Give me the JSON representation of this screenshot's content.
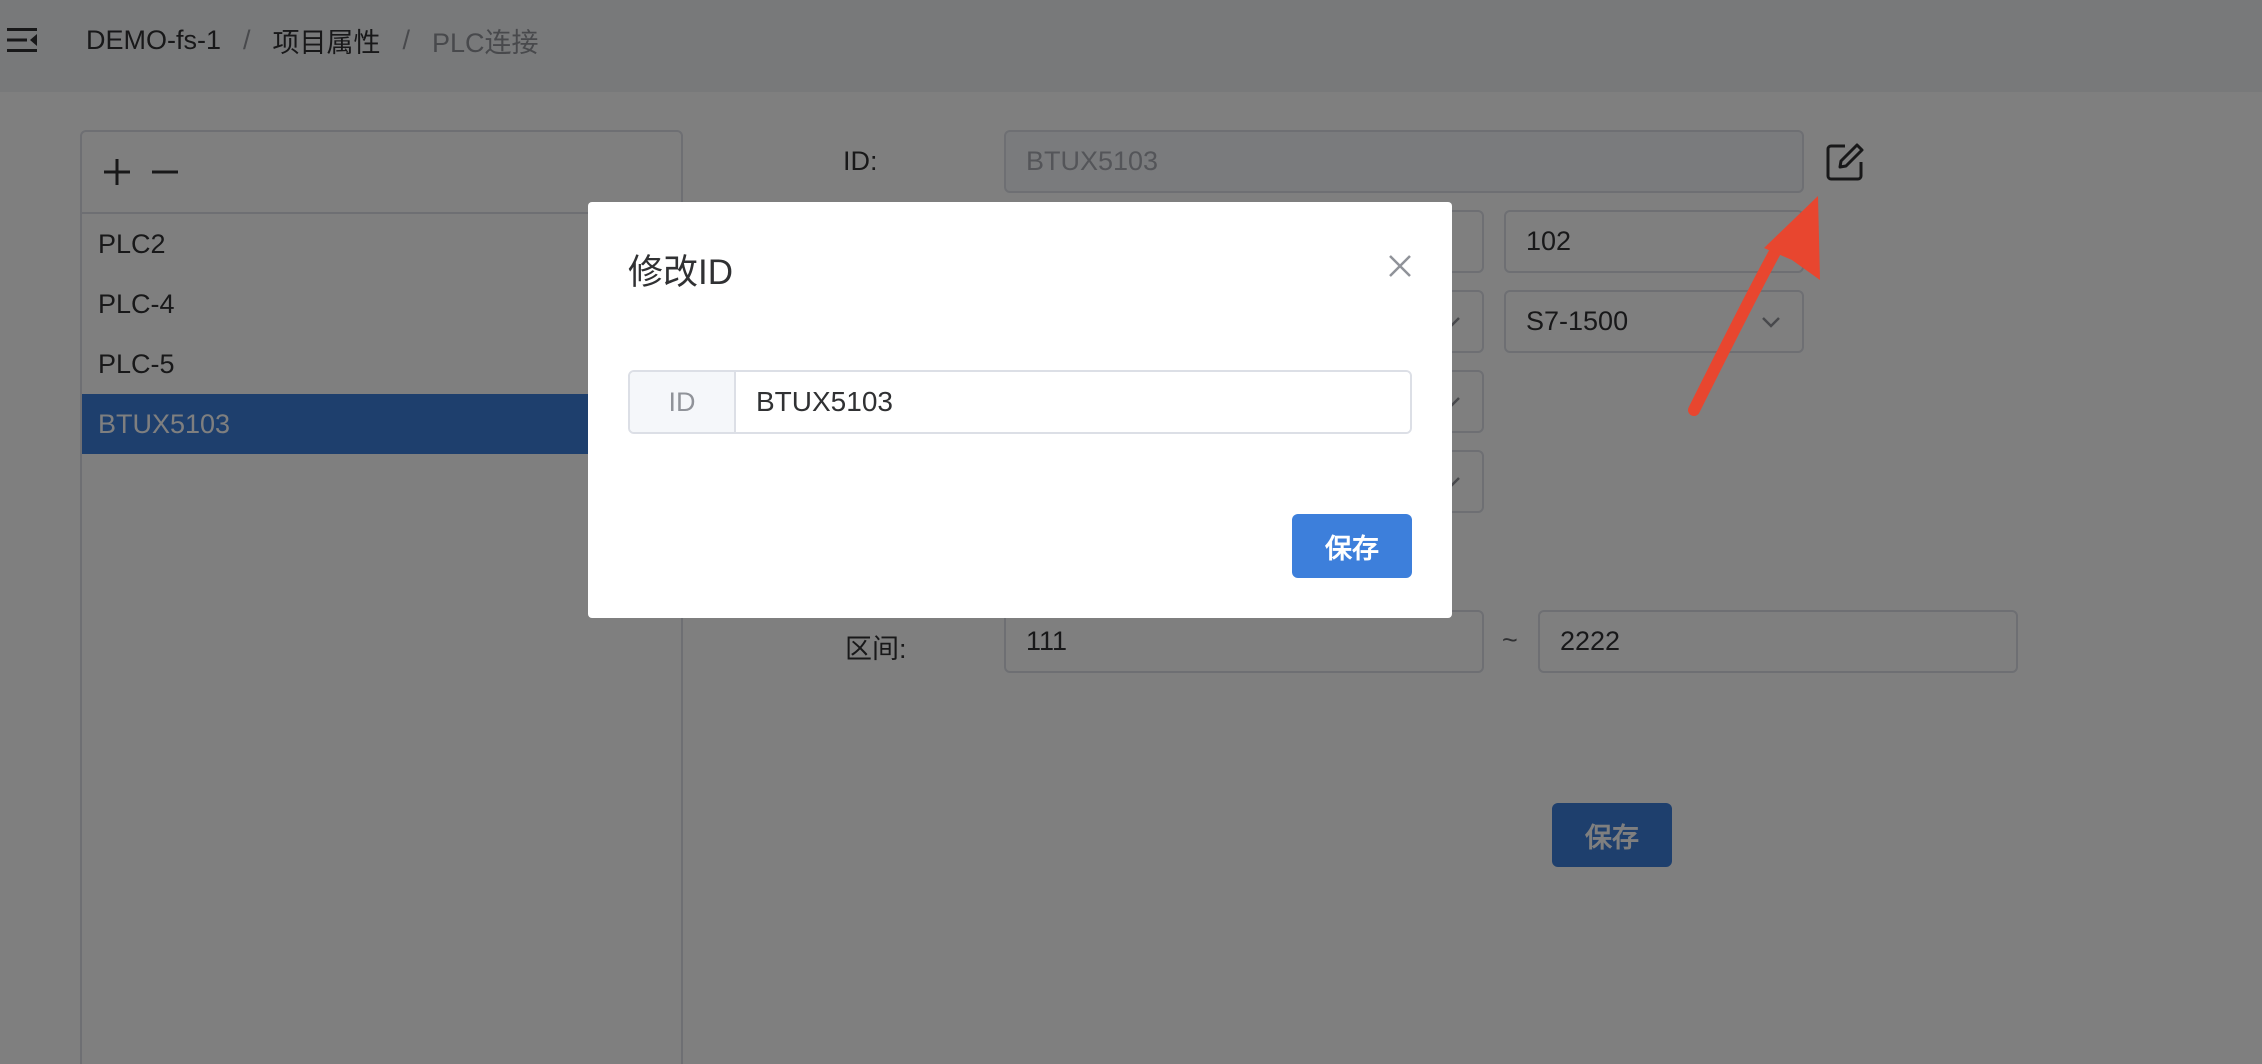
{
  "breadcrumb": {
    "items": [
      "DEMO-fs-1",
      "项目属性"
    ],
    "separator": "/",
    "current": "PLC连接"
  },
  "plc_list": {
    "add_symbol": "+",
    "remove_symbol": "—",
    "items": [
      {
        "label": "PLC2"
      },
      {
        "label": "PLC-4"
      },
      {
        "label": "PLC-5"
      },
      {
        "label": "BTUX5103",
        "selected": true
      }
    ]
  },
  "form": {
    "id_label": "ID:",
    "id_value": "BTUX5103",
    "field_102": "102",
    "model_select": "S7-1500",
    "range_label": "区间:",
    "range_from": "111",
    "range_separator": "~",
    "range_to": "2222",
    "save_label": "保存"
  },
  "dialog": {
    "title": "修改ID",
    "input_prefix": "ID",
    "input_value": "BTUX5103",
    "save_label": "保存"
  },
  "colors": {
    "primary": "#3d7fdb",
    "header_bg": "#f0f2f5",
    "border": "#dcdfe6",
    "annotation": "#e8462f"
  }
}
